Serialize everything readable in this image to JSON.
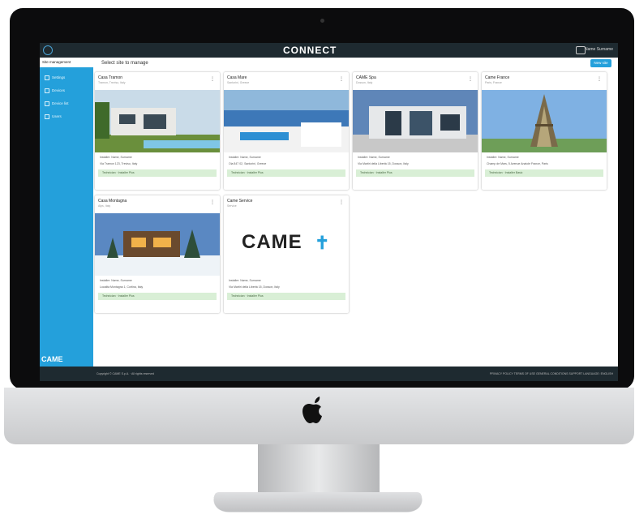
{
  "header": {
    "logo": "CONNECT",
    "user": "Name Surname"
  },
  "sidebar": {
    "head": "Site management",
    "items": [
      "Settings",
      "Devices",
      "Device list",
      "Users"
    ],
    "brand": "CAME"
  },
  "main": {
    "title": "Select site to manage",
    "new_button": "New site"
  },
  "cards": [
    {
      "title": "Casa Tramon",
      "sub": "Tramon, Treviso, Italy",
      "line1": "Installer: Name, Surname",
      "line2": "Via Tramon 123, Treviso, Italy",
      "badge": "Technician · Installer Plus"
    },
    {
      "title": "Casa Mare",
      "sub": "Santorini, Greece",
      "line1": "Installer: Name, Surname",
      "line2": "Oia 847 02, Santorini, Greece",
      "badge": "Technician · Installer Plus"
    },
    {
      "title": "CAME Spa",
      "sub": "Dosson, Italy",
      "line1": "Installer: Name, Surname",
      "line2": "Via Martiri della Libertà 15, Dosson, Italy",
      "badge": "Technician · Installer Plus"
    },
    {
      "title": "Came France",
      "sub": "Paris, France",
      "line1": "Installer: Name, Surname",
      "line2": "Champ de Mars, 5 Avenue Anatole France, Paris",
      "badge": "Technician · Installer Basic"
    },
    {
      "title": "Casa Montagna",
      "sub": "Alps, Italy",
      "line1": "Installer: Name, Surname",
      "line2": "Località Montagna 1, Cortina, Italy",
      "badge": "Technician · Installer Plus"
    },
    {
      "title": "Came Service",
      "sub": "Service",
      "line1": "Installer: Name, Surname",
      "line2": "Via Martiri della Libertà 15, Dosson, Italy",
      "badge": "Technician · Installer Plus"
    }
  ],
  "came_logo_text": "CAME",
  "footer": {
    "copyright": "Copyright © CAME S.p.A. · All rights reserved",
    "links": "PRIVACY POLICY   TERMS OF USE   GENERAL CONDITIONS   SUPPORT   LANGUAGE: ENGLISH"
  },
  "colors": {
    "accent": "#24a0db",
    "bezel": "#0c0c0d",
    "topbar": "#1e2a30",
    "badge": "#d9efd6"
  }
}
